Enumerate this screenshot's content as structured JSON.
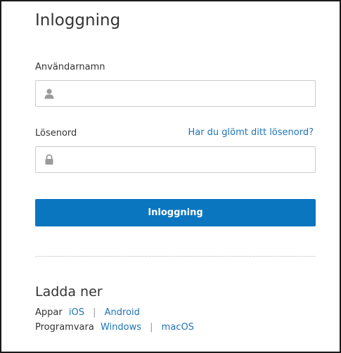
{
  "login": {
    "title": "Inloggning",
    "username_label": "Användarnamn",
    "username_value": "",
    "username_icon": "user-icon",
    "password_label": "Lösenord",
    "password_value": "",
    "password_icon": "lock-icon",
    "forgot_link": "Har du glömt ditt lösenord?",
    "submit_label": "Inloggning"
  },
  "download": {
    "title": "Ladda ner",
    "apps_label": "Appar",
    "apps_links": [
      "iOS",
      "Android"
    ],
    "software_label": "Programvara",
    "software_links": [
      "Windows",
      "macOS"
    ],
    "separator": "|"
  },
  "colors": {
    "accent": "#0b76c0",
    "link": "#1f74b8",
    "text": "#333333",
    "border": "#cccccc"
  }
}
